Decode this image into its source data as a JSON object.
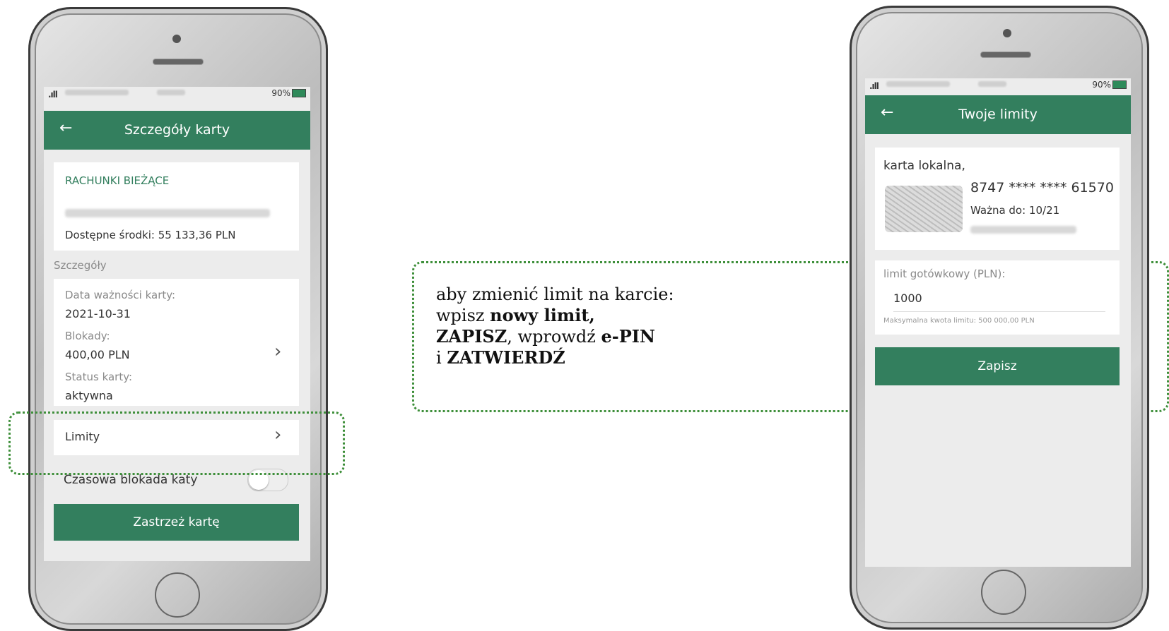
{
  "left_phone": {
    "status": {
      "battery": "90%"
    },
    "header": {
      "back_icon": "arrow-left-icon",
      "title": "Szczegóły karty"
    },
    "account": {
      "type": "RACHUNKI BIEŻĄCE",
      "available": "Dostępne środki: 55 133,36 PLN"
    },
    "details_heading": "Szczegóły",
    "details": {
      "expiry_label": "Data ważności karty:",
      "expiry_value": "2021-10-31",
      "blocks_label": "Blokady:",
      "blocks_value": "400,00 PLN",
      "status_label": "Status karty:",
      "status_value": "aktywna"
    },
    "limits_item": "Limity",
    "temp_block_label": "Czasowa blokada katy",
    "reserve_button": "Zastrzeż kartę"
  },
  "callout": {
    "line1": "aby zmienić limit na karcie:",
    "line2_prefix": "wpisz ",
    "line2_bold": "nowy limit,",
    "line3_bold1": "ZAPISZ",
    "line3_mid": ", wprowdź ",
    "line3_bold2": "e-PIN",
    "line4_prefix": "i ",
    "line4_bold": "ZATWIERDŹ"
  },
  "right_phone": {
    "status": {
      "battery": "90%"
    },
    "header": {
      "back_icon": "arrow-left-icon",
      "title": "Twoje limity"
    },
    "card": {
      "type": "karta lokalna,",
      "number": "8747 **** **** 61570",
      "valid": "Ważna do: 10/21"
    },
    "limit": {
      "label": "limit gotówkowy (PLN):",
      "value": "1000",
      "hint": "Maksymalna kwota limitu: 500 000,00 PLN"
    },
    "save_button": "Zapisz"
  },
  "colors": {
    "brand_green": "#337f5e",
    "highlight_dotted": "#3e8f3a"
  }
}
